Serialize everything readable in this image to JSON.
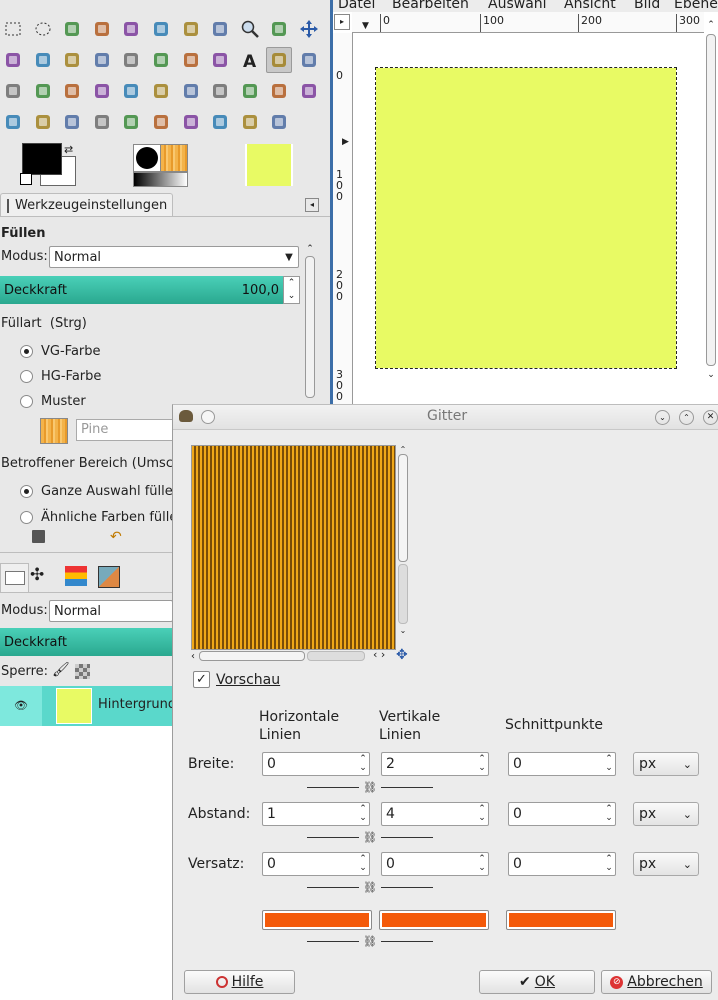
{
  "dock": {
    "toolbox": {
      "tools": [
        "rect-select-icon",
        "ellipse-select-icon",
        "lasso-icon",
        "magic-wand-icon",
        "select-by-color-icon",
        "scissors-icon",
        "foreground-select-icon",
        "color-picker-icon",
        "zoom-icon",
        "measure-icon",
        "move-icon",
        "align-icon",
        "crop-icon",
        "rotate-icon",
        "scale-icon",
        "shear-icon",
        "perspective-icon",
        "flip-icon",
        "cage-icon",
        "text-icon",
        "bucket-fill-icon",
        "blend-icon",
        "pencil-icon",
        "paintbrush-icon",
        "eraser-icon",
        "airbrush-icon",
        "ink-icon",
        "clone-icon",
        "heal-icon",
        "perspective-clone-icon",
        "blur-icon",
        "smudge-icon",
        "dodge-icon",
        "paths-icon",
        "levels-icon",
        "color-balance-icon",
        "hue-saturation-icon",
        "threshold-icon",
        "colorize-icon",
        "brightness-icon",
        "curves-icon",
        "posterize-icon",
        "desaturate-icon"
      ],
      "colors": {
        "foreground": "#000000",
        "background": "#ffffff",
        "image_thumb": "#e8fa64"
      }
    },
    "tool_options": {
      "tab_label": "Werkzeugeinstellungen",
      "title": "Füllen",
      "mode_label": "Modus:",
      "mode_value": "Normal",
      "opacity_label": "Deckkraft",
      "opacity_value": "100,0",
      "fill_type_label": "Füllart  (Strg)",
      "fill_options": [
        "VG-Farbe",
        "HG-Farbe",
        "Muster"
      ],
      "pattern_value": "Pine",
      "affected_label": "Betroffener Bereich (Umsch",
      "affected_options": [
        "Ganze Auswahl füllen",
        "Ähnliche Farben fülle"
      ]
    },
    "layers": {
      "mode_label": "Modus:",
      "mode_value": "Normal",
      "opacity_label": "Deckkraft",
      "lock_label": "Sperre:",
      "layer_name": "Hintergrund"
    }
  },
  "image_window": {
    "menu": [
      "Datei",
      "Bearbeiten",
      "Auswahl",
      "Ansicht",
      "Bild",
      "Ebene"
    ],
    "ruler_h": [
      "0",
      "100",
      "200",
      "300"
    ],
    "ruler_v": [
      "0",
      "100",
      "200",
      "300"
    ],
    "canvas_color": "#e8fa64"
  },
  "dialog": {
    "title": "Gitter",
    "preview_label": "Vorschau",
    "columns": {
      "horizontal": "Horizontale Linien",
      "vertical": "Vertikale Linien",
      "intersections": "Schnittpunkte"
    },
    "rows": [
      {
        "label": "Breite:",
        "h": "0",
        "v": "2",
        "i": "0",
        "unit": "px"
      },
      {
        "label": "Abstand:",
        "h": "1",
        "v": "4",
        "i": "0",
        "unit": "px"
      },
      {
        "label": "Versatz:",
        "h": "0",
        "v": "0",
        "i": "0",
        "unit": "px"
      }
    ],
    "line_color": "#f45a0a",
    "buttons": {
      "help": "Hilfe",
      "ok": "OK",
      "cancel": "Abbrechen"
    }
  }
}
